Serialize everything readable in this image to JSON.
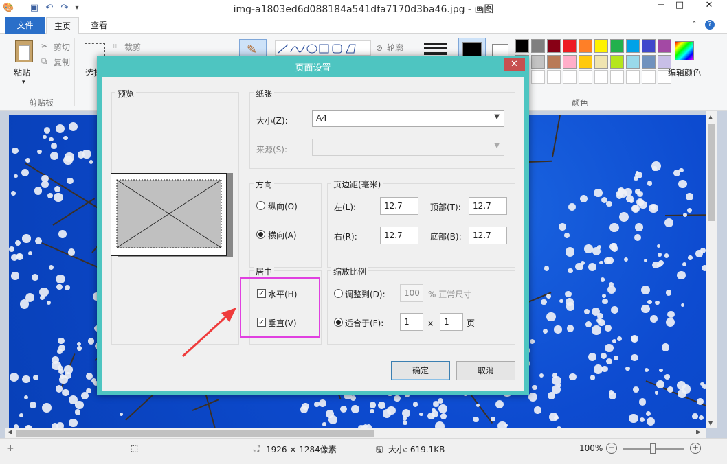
{
  "window": {
    "title": "img-a1803ed6d088184a541dfa7170d3ba46.jpg - 画图",
    "minimize": "−",
    "maximize": "□",
    "close": "✕"
  },
  "tabs": {
    "file": "文件",
    "home": "主页",
    "view": "查看"
  },
  "ribbon": {
    "paste": "粘贴",
    "cut": "剪切",
    "copy": "复制",
    "clipboard_group": "剪贴板",
    "select": "选择",
    "crop": "裁剪",
    "outline": "轮廓",
    "edit_colors": "编辑颜色",
    "colors_group": "颜色",
    "palette_row1": [
      "#000000",
      "#7f7f7f",
      "#880015",
      "#ed1c24",
      "#ff7f27",
      "#fff200",
      "#22b14c",
      "#00a2e8",
      "#3f48cc",
      "#a349a4"
    ],
    "palette_row2": [
      "#ffffff",
      "#c3c3c3",
      "#b97a57",
      "#ffaec9",
      "#ffc90e",
      "#efe4b0",
      "#b5e61d",
      "#99d9ea",
      "#7092be",
      "#c8bfe7"
    ]
  },
  "dialog": {
    "title": "页面设置",
    "close": "✕",
    "preview_label": "预览",
    "paper_label": "纸张",
    "size_label": "大小(Z):",
    "size_value": "A4",
    "source_label": "来源(S):",
    "source_value": "",
    "orientation_label": "方向",
    "portrait_label": "纵向(O)",
    "landscape_label": "横向(A)",
    "orientation_selected": "landscape",
    "margins_label": "页边距(毫米)",
    "left_label": "左(L):",
    "left_value": "12.7",
    "top_label": "顶部(T):",
    "top_value": "12.7",
    "right_label": "右(R):",
    "right_value": "12.7",
    "bottom_label": "底部(B):",
    "bottom_value": "12.7",
    "center_label": "居中",
    "horizontal_label": "水平(H)",
    "horizontal_checked": true,
    "vertical_label": "垂直(V)",
    "vertical_checked": true,
    "scale_label": "缩放比例",
    "adjust_label": "调整到(D):",
    "adjust_value": "100",
    "adjust_suffix": "% 正常尺寸",
    "fit_label": "适合于(F):",
    "fit_x": "1",
    "fit_times": "x",
    "fit_y": "1",
    "fit_suffix": "页",
    "ok": "确定",
    "cancel": "取消"
  },
  "status": {
    "dimensions": "1926 × 1284像素",
    "size": "大小: 619.1KB",
    "zoom": "100%"
  },
  "annotation": {
    "highlight_color": "#e040e0",
    "arrow_color": "#ef3b3b"
  }
}
